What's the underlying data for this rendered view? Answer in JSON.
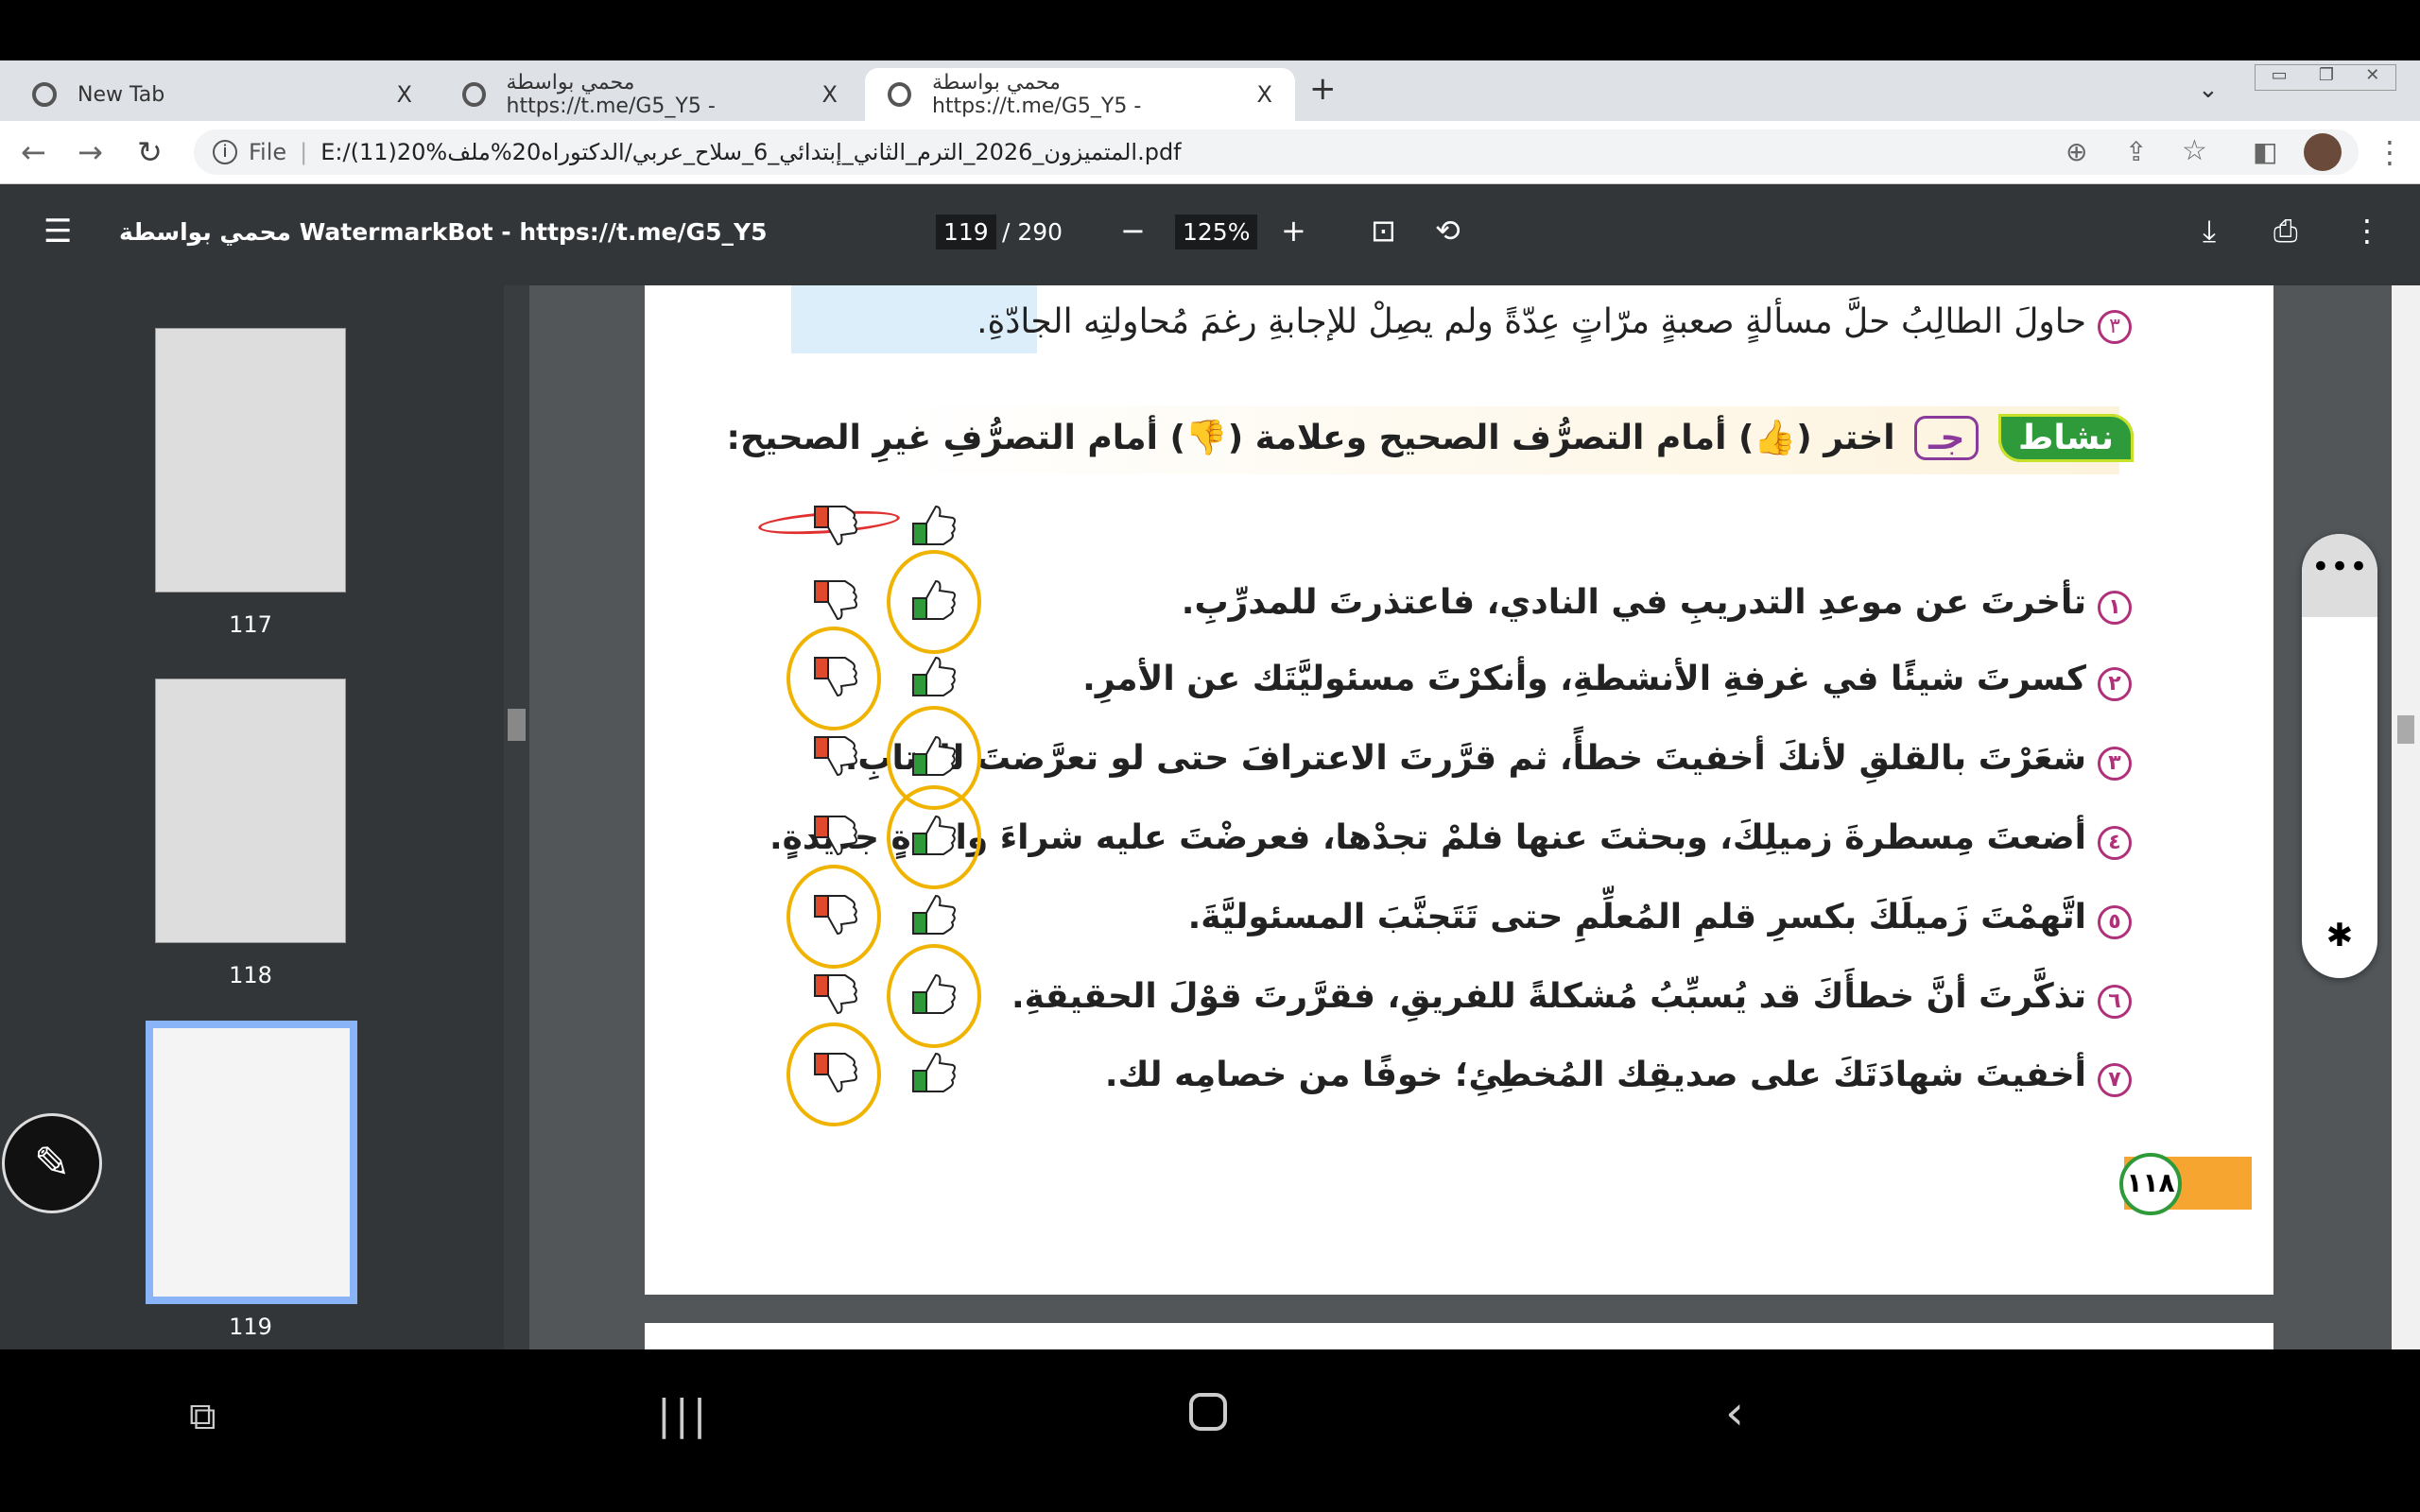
{
  "tabs": [
    {
      "title": "New Tab",
      "close": "X"
    },
    {
      "title": "محمي بواسطة https://t.me/G5_Y5 -",
      "close": "X"
    },
    {
      "title": "محمي بواسطة https://t.me/G5_Y5 -",
      "close": "X"
    }
  ],
  "new_tab": "+",
  "address": {
    "scheme": "File",
    "url": "E:/(11)20%المتميزون_2026_الترم_الثاني_إبتدائي_6_سلاح_عربي/الدكتوراه20%ملف.pdf"
  },
  "pdf": {
    "title": "محمي بواسطة WatermarkBot - https://t.me/G5_Y5",
    "page": "119",
    "total": "/ 290",
    "zoom": "125%",
    "minus": "−",
    "plus": "+"
  },
  "thumbnails": [
    {
      "label": "117"
    },
    {
      "label": "118"
    },
    {
      "label": "119"
    }
  ],
  "content": {
    "prev_item": {
      "num": "٣",
      "text": "حاولَ الطالِبُ حلَّ مسألةٍ صعبةٍ مرّاتٍ عِدّةً ولم يصِلْ للإجابةِ رغمَ مُحاولتِه الجادّةِ."
    },
    "activity": {
      "badge": "نشاط",
      "letter": "جـ",
      "instruction": "اختر (👍) أمام التصرُّف الصحيح وعلامة (👎) أمام التصرُّفِ غيرِ الصحيح:"
    },
    "items": [
      {
        "num": "١",
        "text": "تأخرتَ عن موعدِ التدريبِ في النادي، فاعتذرتَ للمدرِّبِ.",
        "circled": "up"
      },
      {
        "num": "٢",
        "text": "كسرتَ شيئًا في غرفةِ الأنشطةِ، وأنكرْتَ مسئوليَّتَك عن الأمرِ.",
        "circled": "down"
      },
      {
        "num": "٣",
        "text": "شعَرْتَ بالقلقِ لأنكَ أخفيتَ خطأً، ثم قرَّرتَ الاعترافَ حتى لو تعرَّضتَ للعتابِ.",
        "circled": "up"
      },
      {
        "num": "٤",
        "text": "أضعتَ مِسطرةَ زميلِكَ، وبحثتَ عنها فلمْ تجدْها، فعرضْتَ عليه شراءَ واحدةٍ جديدةٍ.",
        "circled": "up"
      },
      {
        "num": "٥",
        "text": "اتَّهمْتَ زَميلَكَ بكسرِ قلمِ المُعلِّمِ حتى تَتَجنَّبَ المسئوليَّةَ.",
        "circled": "down"
      },
      {
        "num": "٦",
        "text": "تذكَّرتَ أنَّ خطأَكَ قد يُسبِّبُ مُشكلةً للفريقِ، فقرَّرتَ قوْلَ الحقيقةِ.",
        "circled": "up"
      },
      {
        "num": "٧",
        "text": "أخفيتَ شهادَتَكَ على صديقِك المُخطِئِ؛ خوفًا من خصامِه لك.",
        "circled": "down"
      }
    ],
    "page_number": "١١٨"
  },
  "colors": {
    "green": "#2e9a3a",
    "red": "#e0492b",
    "circle": "#f0b400",
    "magenta": "#b0307a"
  }
}
